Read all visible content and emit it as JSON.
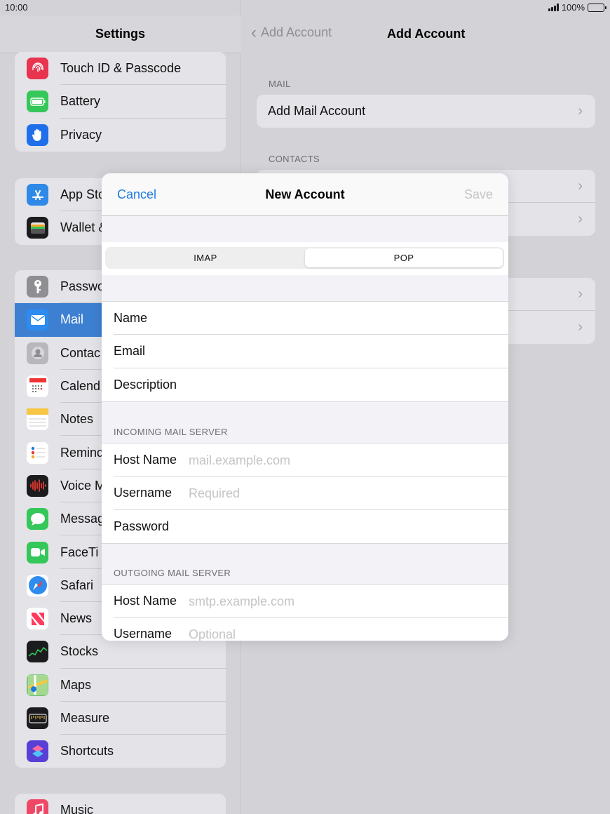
{
  "status": {
    "time": "10:00",
    "battery": "100%"
  },
  "left": {
    "title": "Settings",
    "group1": [
      {
        "label": "Touch ID & Passcode",
        "icon": "fingerprint-icon"
      },
      {
        "label": "Battery",
        "icon": "battery-icon"
      },
      {
        "label": "Privacy",
        "icon": "hand-icon"
      }
    ],
    "group2": [
      {
        "label": "App Sto",
        "icon": "app-store-icon"
      },
      {
        "label": "Wallet &",
        "icon": "wallet-icon"
      }
    ],
    "group3": [
      {
        "label": "Passwo",
        "icon": "key-icon"
      },
      {
        "label": "Mail",
        "icon": "mail-icon",
        "selected": true
      },
      {
        "label": "Contac",
        "icon": "contacts-icon"
      },
      {
        "label": "Calend",
        "icon": "calendar-icon"
      },
      {
        "label": "Notes",
        "icon": "notes-icon"
      },
      {
        "label": "Remind",
        "icon": "reminders-icon"
      },
      {
        "label": "Voice M",
        "icon": "voice-memos-icon"
      },
      {
        "label": "Messag",
        "icon": "messages-icon"
      },
      {
        "label": "FaceTi",
        "icon": "facetime-icon"
      },
      {
        "label": "Safari",
        "icon": "safari-icon"
      },
      {
        "label": "News",
        "icon": "news-icon"
      },
      {
        "label": "Stocks",
        "icon": "stocks-icon"
      },
      {
        "label": "Maps",
        "icon": "maps-icon"
      },
      {
        "label": "Measure",
        "icon": "measure-icon"
      },
      {
        "label": "Shortcuts",
        "icon": "shortcuts-icon"
      }
    ],
    "group4": [
      {
        "label": "Music",
        "icon": "music-icon"
      }
    ]
  },
  "right": {
    "back": "Add Account",
    "title": "Add Account",
    "mail_caption": "MAIL",
    "add_mail": "Add Mail Account",
    "contacts_caption": "CONTACTS"
  },
  "modal": {
    "cancel": "Cancel",
    "title": "New Account",
    "save": "Save",
    "segments": {
      "imap": "IMAP",
      "pop": "POP",
      "selected": "POP"
    },
    "fields": {
      "name": "Name",
      "email": "Email",
      "description": "Description"
    },
    "incoming": {
      "caption": "INCOMING MAIL SERVER",
      "host_label": "Host Name",
      "host_placeholder": "mail.example.com",
      "user_label": "Username",
      "user_placeholder": "Required",
      "pass_label": "Password"
    },
    "outgoing": {
      "caption": "OUTGOING MAIL SERVER",
      "host_label": "Host Name",
      "host_placeholder": "smtp.example.com",
      "user_label": "Username",
      "user_placeholder": "Optional"
    }
  },
  "colors": {
    "accent": "#1f7ae0",
    "selected_row": "#3d7fd1"
  }
}
